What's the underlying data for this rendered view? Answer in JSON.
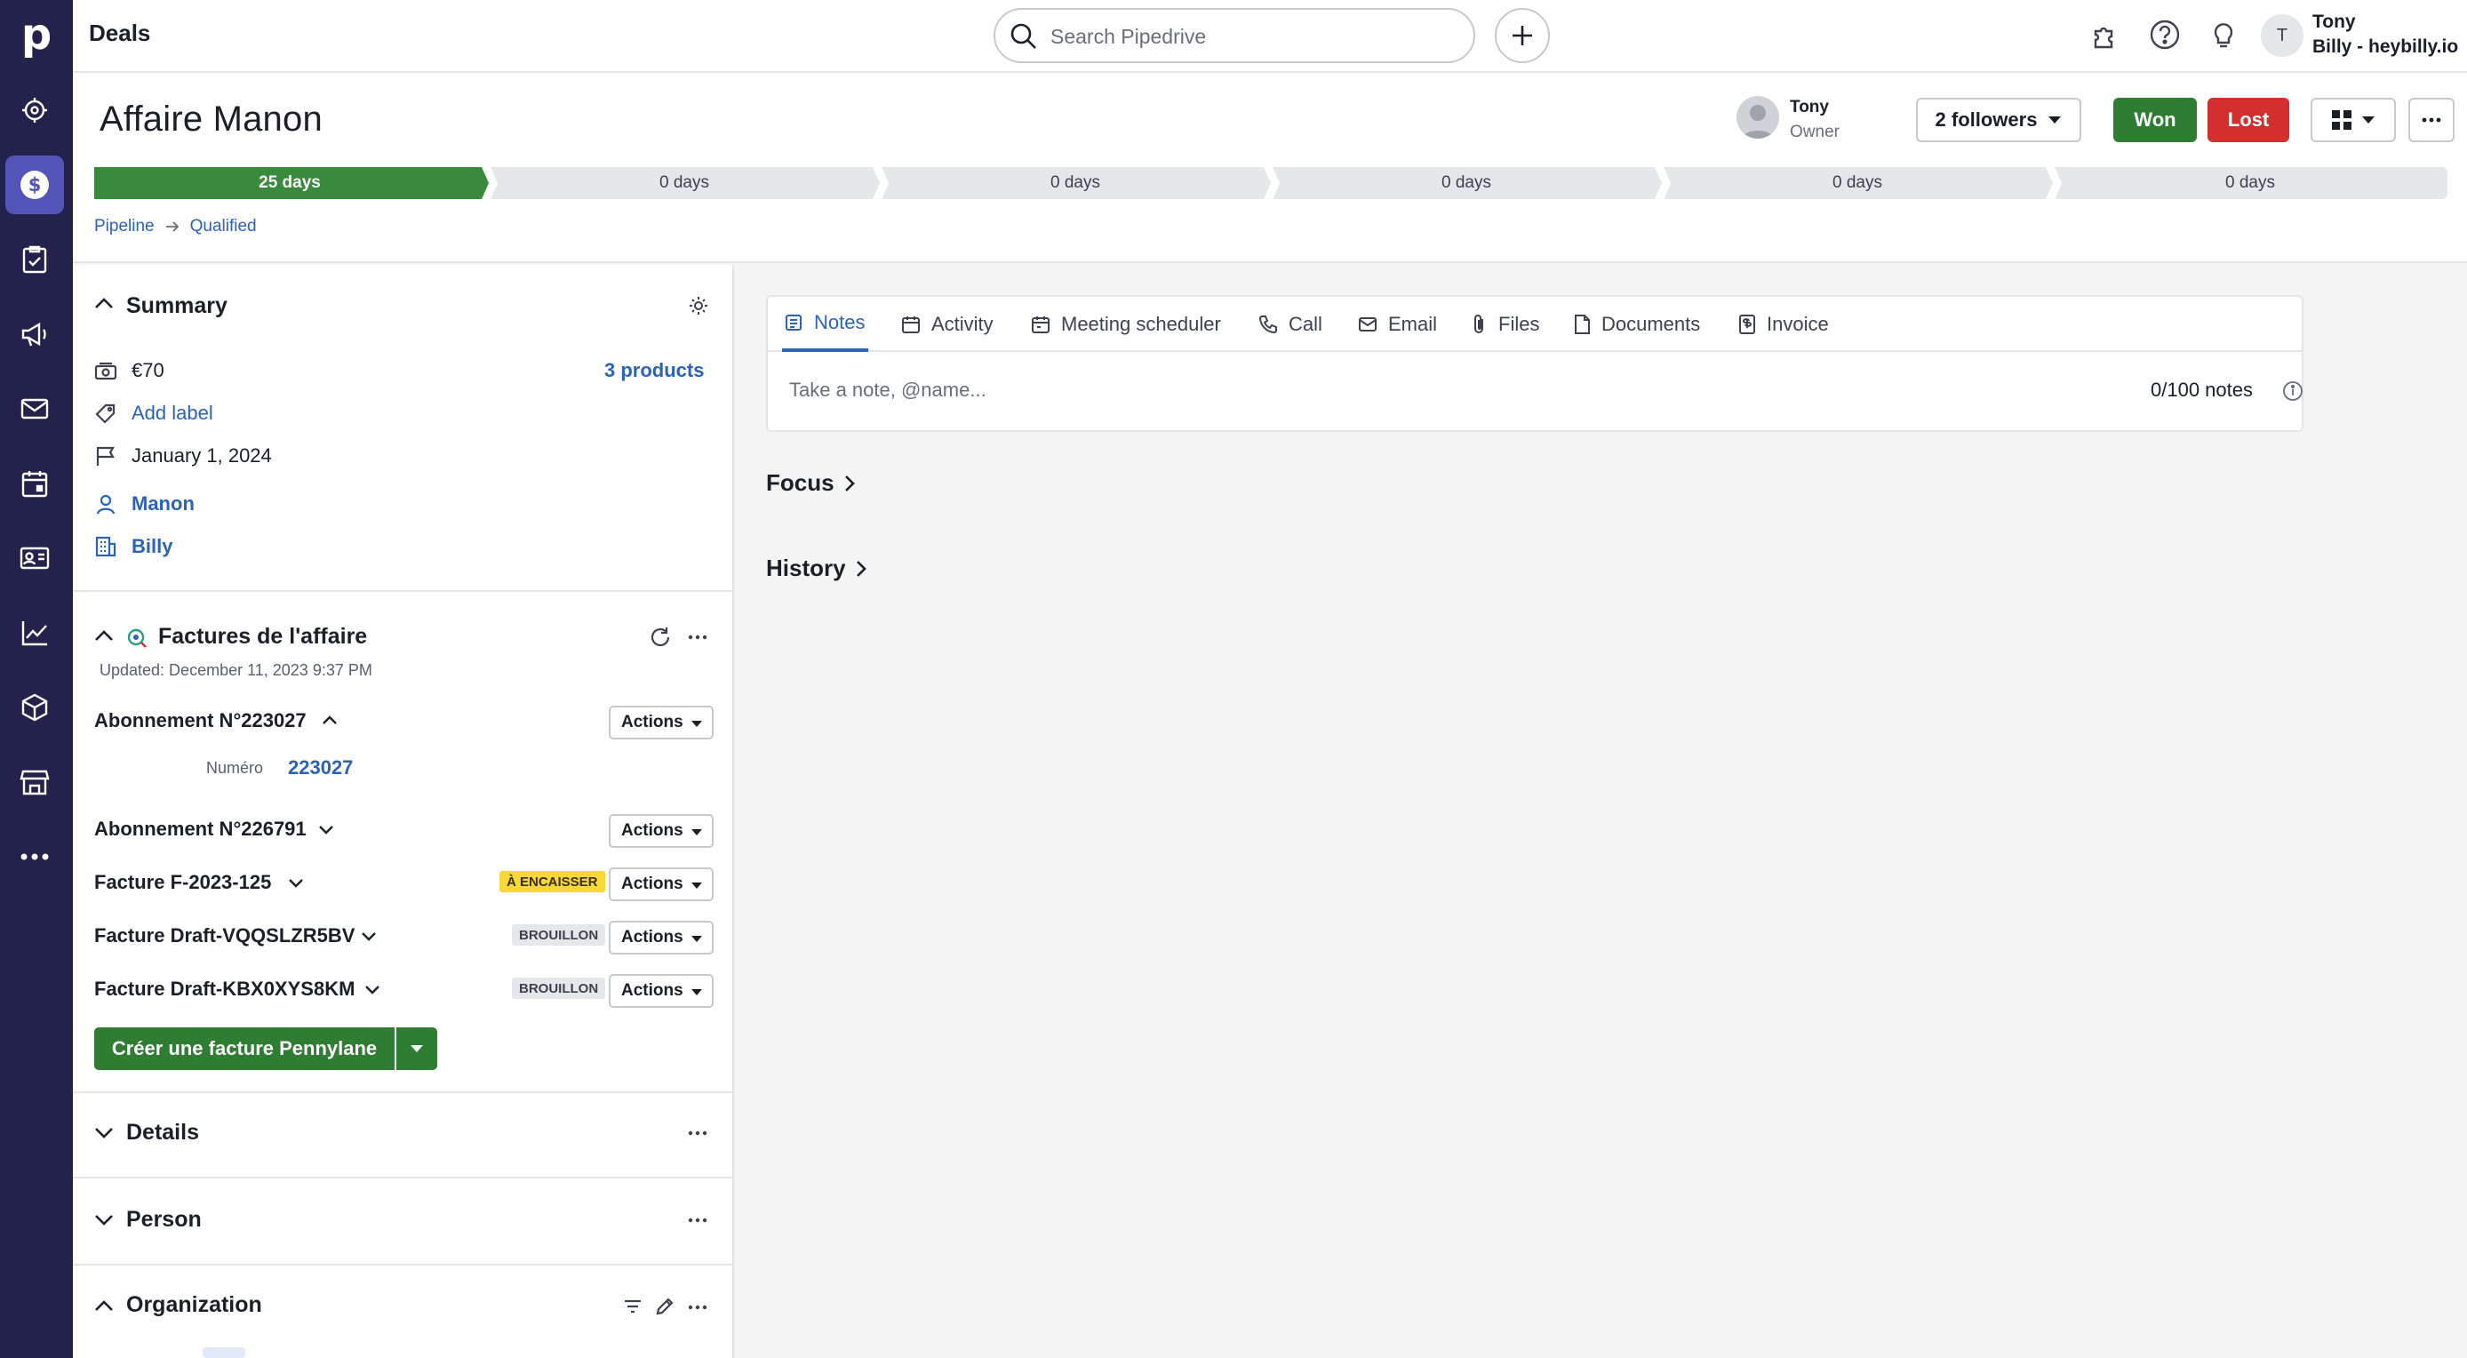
{
  "app": {
    "logo_letter": "p",
    "page_title": "Deals"
  },
  "search": {
    "placeholder": "Search Pipedrive"
  },
  "user": {
    "initial": "T",
    "name": "Tony",
    "company": "Billy - heybilly.io"
  },
  "deal": {
    "title": "Affaire Manon",
    "owner_name": "Tony",
    "owner_role": "Owner",
    "followers_label": "2 followers",
    "won_label": "Won",
    "lost_label": "Lost"
  },
  "stages": [
    {
      "label": "25 days",
      "done": true
    },
    {
      "label": "0 days",
      "done": false
    },
    {
      "label": "0 days",
      "done": false
    },
    {
      "label": "0 days",
      "done": false
    },
    {
      "label": "0 days",
      "done": false
    },
    {
      "label": "0 days",
      "done": false
    }
  ],
  "breadcrumb": {
    "pipeline": "Pipeline",
    "stage": "Qualified"
  },
  "summary": {
    "title": "Summary",
    "value": "€70",
    "products": "3 products",
    "add_label": "Add label",
    "close_date": "January 1, 2024",
    "person": "Manon",
    "organization": "Billy"
  },
  "invoices": {
    "title": "Factures de l'affaire",
    "updated": "Updated: December 11, 2023 9:37 PM",
    "actions_label": "Actions",
    "numero_label": "Numéro",
    "numero_value": "223027",
    "items": [
      {
        "title": "Abonnement N°223027",
        "badge": ""
      },
      {
        "title": "Abonnement N°226791",
        "badge": ""
      },
      {
        "title": "Facture F-2023-125",
        "badge": "À ENCAISSER"
      },
      {
        "title": "Facture Draft-VQQSLZR5BV",
        "badge": "BROUILLON"
      },
      {
        "title": "Facture Draft-KBX0XYS8KM",
        "badge": "BROUILLON"
      }
    ],
    "create_label": "Créer une facture Pennylane"
  },
  "sections": {
    "details": "Details",
    "person": "Person",
    "organization": "Organization"
  },
  "tabs": [
    {
      "label": "Notes",
      "icon": "note-icon"
    },
    {
      "label": "Activity",
      "icon": "calendar-icon"
    },
    {
      "label": "Meeting scheduler",
      "icon": "meeting-icon"
    },
    {
      "label": "Call",
      "icon": "phone-icon"
    },
    {
      "label": "Email",
      "icon": "mail-icon"
    },
    {
      "label": "Files",
      "icon": "paperclip-icon"
    },
    {
      "label": "Documents",
      "icon": "document-icon"
    },
    {
      "label": "Invoice",
      "icon": "invoice-icon"
    }
  ],
  "notes": {
    "placeholder": "Take a note, @name...",
    "count": "0/100 notes"
  },
  "feed": {
    "focus": "Focus",
    "history": "History"
  },
  "colors": {
    "nav_bg": "#23224d",
    "nav_active": "#5354b8",
    "won": "#2e7d32",
    "lost": "#d32f2f",
    "link": "#2a63b8",
    "stage_done": "#3a8a3e"
  }
}
